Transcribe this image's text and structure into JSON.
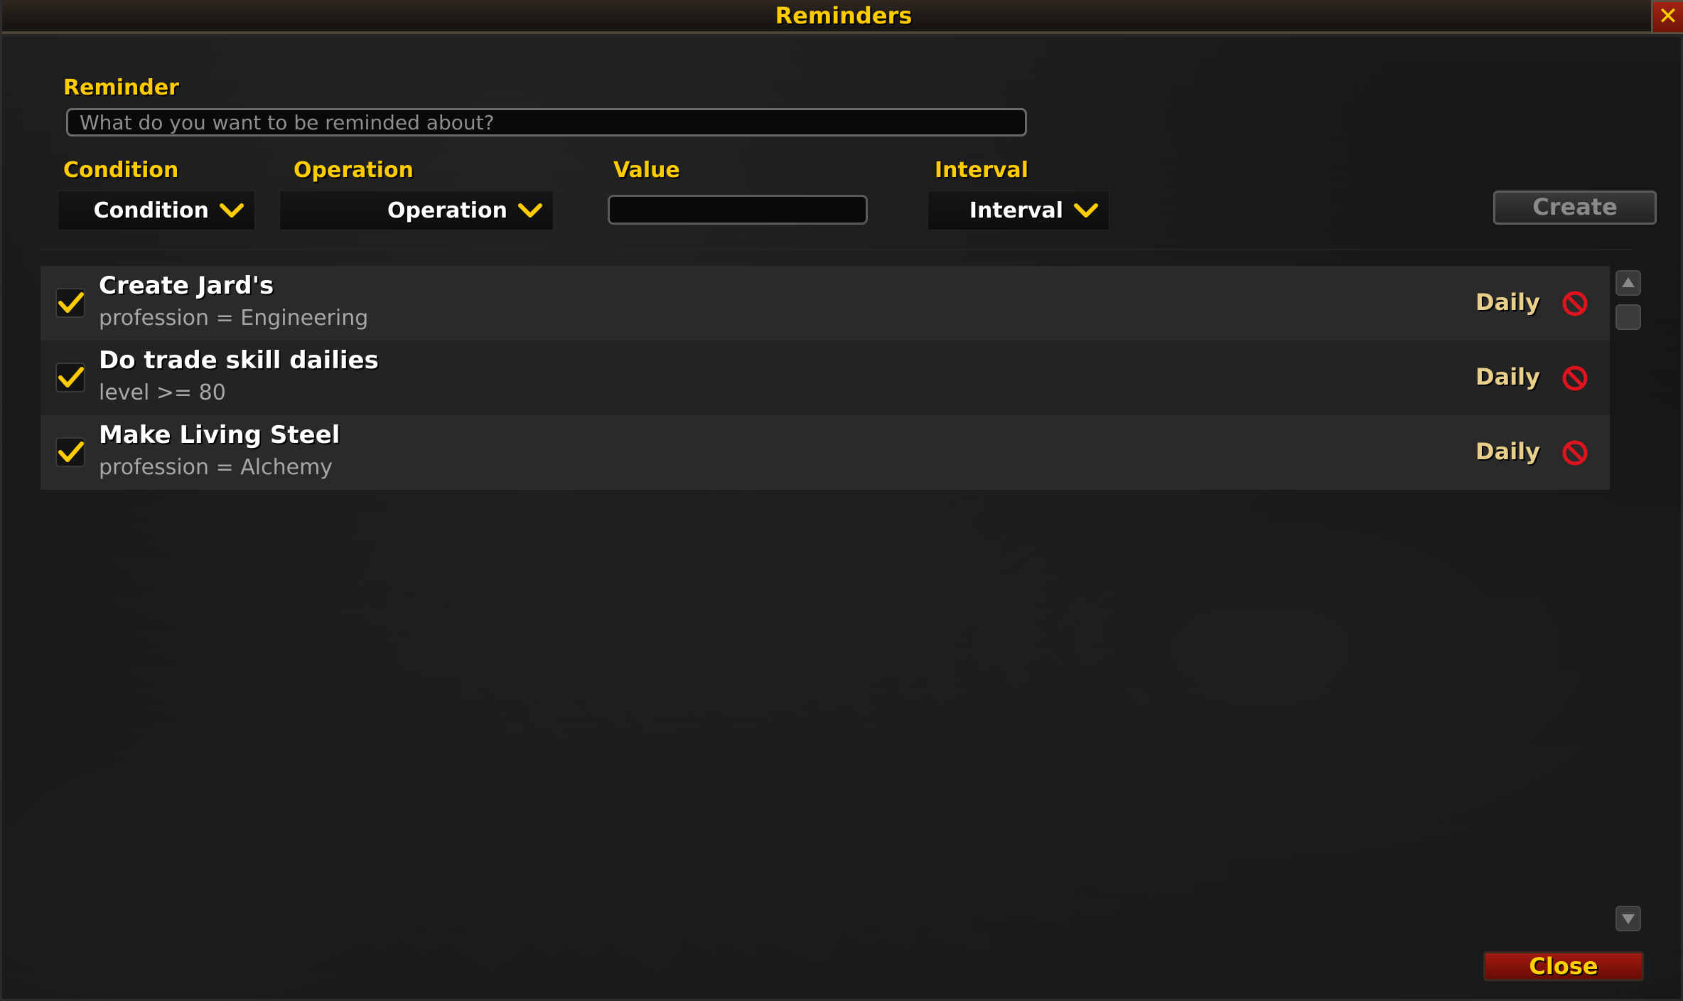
{
  "window": {
    "title": "Reminders"
  },
  "form": {
    "reminder_label": "Reminder",
    "reminder_placeholder": "What do you want to be reminded about?",
    "reminder_value": "",
    "condition_label": "Condition",
    "condition_selected": "Condition",
    "operation_label": "Operation",
    "operation_selected": "Operation",
    "value_label": "Value",
    "value_value": "",
    "interval_label": "Interval",
    "interval_selected": "Interval",
    "create_label": "Create"
  },
  "reminders": [
    {
      "title": "Create Jard's",
      "condition": "profession = Engineering",
      "interval": "Daily",
      "checked": true
    },
    {
      "title": "Do trade skill dailies",
      "condition": "level >= 80",
      "interval": "Daily",
      "checked": true
    },
    {
      "title": "Make Living Steel",
      "condition": "profession = Alchemy",
      "interval": "Daily",
      "checked": true
    }
  ],
  "footer": {
    "close_label": "Close"
  },
  "icons": {
    "close_window": "close-x-icon",
    "dropdown": "chevron-down-icon",
    "check": "checkmark-icon",
    "delete": "no-entry-icon",
    "scroll_up": "scroll-up-arrow-icon",
    "scroll_down": "scroll-down-arrow-icon"
  },
  "colors": {
    "accent_gold": "#ffcc00",
    "delete_red": "#e0141e",
    "close_button_red": "#a01a10"
  }
}
